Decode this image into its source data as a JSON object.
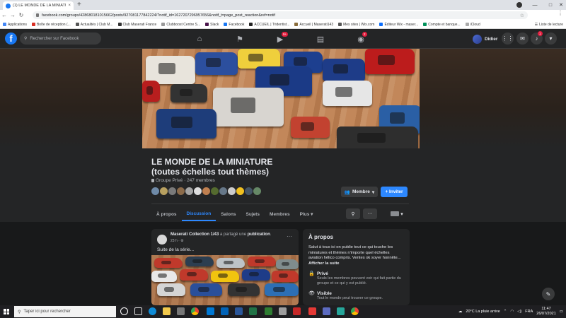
{
  "browser": {
    "tab_title": "(1) LE MONDE DE LA MINIATURE",
    "tab_close": "×",
    "new_tab": "+",
    "url": "facebook.com/groups/428680181015662/posts/927081177842224/?notif_id=1627207296957656&notif_t=page_post_reaction&ref=notif",
    "bookmarks": [
      {
        "label": "Applications",
        "color": "#4285f4"
      },
      {
        "label": "Boîte de réception (...",
        "color": "#d93025"
      },
      {
        "label": "Actualités | Club M...",
        "color": "#555555"
      },
      {
        "label": "Club Maserati France",
        "color": "#333333"
      },
      {
        "label": "Clubboost Centre S...",
        "color": "#999999"
      },
      {
        "label": "Slack",
        "color": "#4a154b"
      },
      {
        "label": "Facebook",
        "color": "#1877f2"
      },
      {
        "label": "ACCUEIL | Tridentist...",
        "color": "#222222"
      },
      {
        "label": "Accueil | Maserati143",
        "color": "#8a6d3b"
      },
      {
        "label": "Mes sites | Wix.com",
        "color": "#555555"
      },
      {
        "label": "Éditeur Wix - maser...",
        "color": "#0c6efc"
      },
      {
        "label": "Compte et banque...",
        "color": "#00915a"
      },
      {
        "label": "iCloud",
        "color": "#aaaaaa"
      }
    ],
    "reading_list": "Liste de lecture"
  },
  "fb_header": {
    "logo": "f",
    "search_placeholder": "Rechercher sur Facebook",
    "video_badge": "9+",
    "gaming_badge": "2",
    "user_name": "Didier",
    "notif_badge": "1"
  },
  "group": {
    "title_line1": "LE MONDE DE LA MINIATURE",
    "title_line2": "(toutes échelles tout thèmes)",
    "privacy_text": "Groupe Privé · 247 membres",
    "member_avatar_colors": [
      "#6f8aa8",
      "#b8a060",
      "#7a7a7a",
      "#8c6b4a",
      "#a5a5a5",
      "#dddddd",
      "#c08050",
      "#556b2f",
      "#667788",
      "#cccccc",
      "#f0c020",
      "#445566",
      "#668866"
    ],
    "membre_button": "Membre",
    "inviter_button": "+ Inviter",
    "tabs": [
      "À propos",
      "Discussion",
      "Salons",
      "Sujets",
      "Membres",
      "Plus ▾"
    ],
    "active_tab_index": 1
  },
  "post": {
    "author": "Maserati Collection 1/43",
    "action": " a partagé une ",
    "object": "publication",
    "suffix": ".",
    "time": "23 h · ⚙",
    "text": "Suite de la série...",
    "more": "···"
  },
  "about": {
    "title": "À propos",
    "description": "Salut à tous ici on publie tout ce qui touche les miniatures et thèmes n'importe quel échelles aviation hélico compris. Ventes ok soyer honnête... ",
    "see_more": "Afficher la suite",
    "private_title": "Privé",
    "private_desc": "Seuls les membres peuvent voir qui fait partie du groupe et ce qui y est publié.",
    "visible_title": "Visible",
    "visible_desc": "Tout le monde peut trouver ce groupe."
  },
  "taskbar": {
    "search_placeholder": "Taper ici pour rechercher",
    "weather": "20°C  La pluie arrive",
    "lang": "FRA",
    "time": "11:47",
    "date": "26/07/2021"
  }
}
